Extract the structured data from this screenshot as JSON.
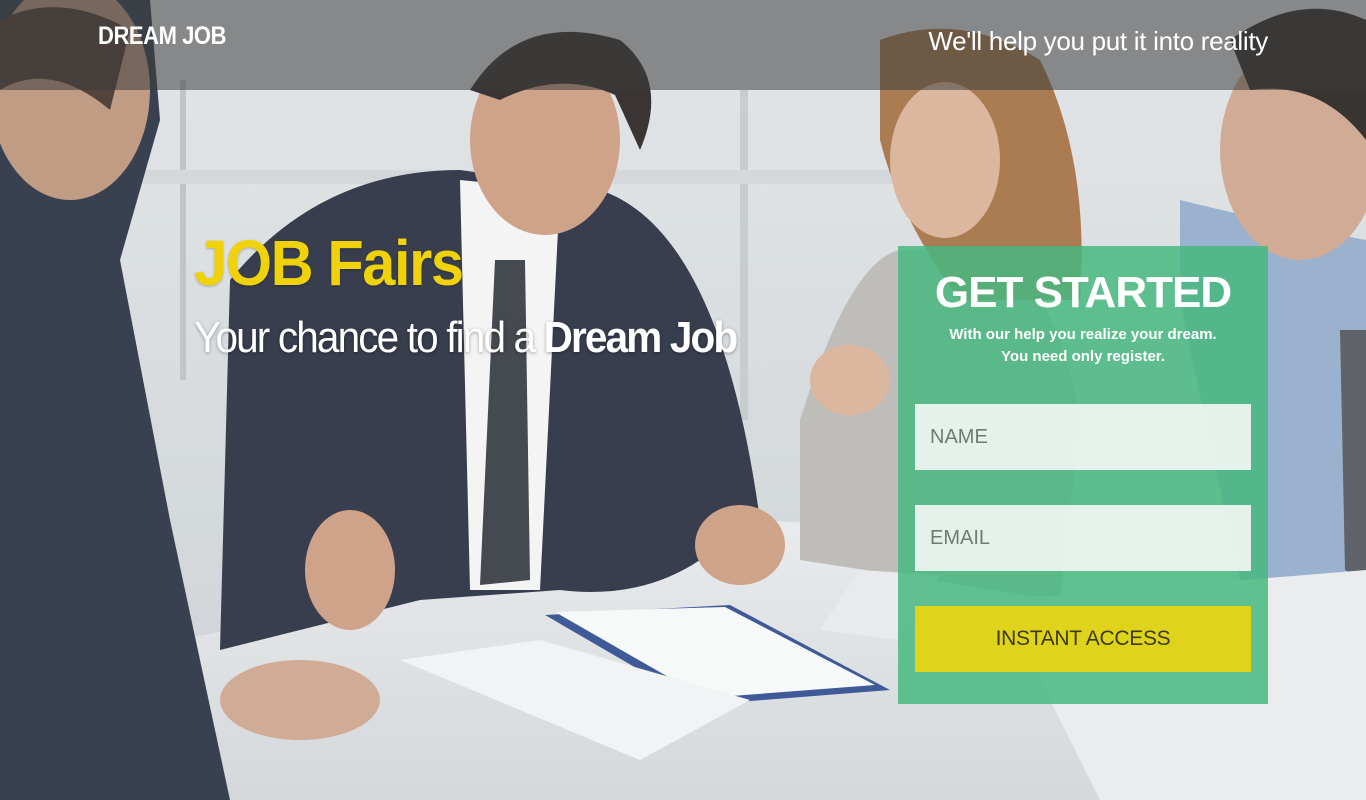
{
  "header": {
    "brand": "DREAM JOB",
    "tagline": "We'll help you put it into reality"
  },
  "hero": {
    "title": "JOB Fairs",
    "subtitle_prefix": "Your chance to find a ",
    "subtitle_emphasis": "Dream Job"
  },
  "signup": {
    "title": "GET STARTED",
    "description_line1": "With our help you realize your dream.",
    "description_line2": "You need only register.",
    "name_placeholder": "NAME",
    "email_placeholder": "EMAIL",
    "submit_label": "INSTANT ACCESS"
  },
  "colors": {
    "accent_yellow": "#f0d20a",
    "card_green": "#48b880",
    "button_yellow": "#e0d31c",
    "header_overlay": "#3c3c3c"
  }
}
